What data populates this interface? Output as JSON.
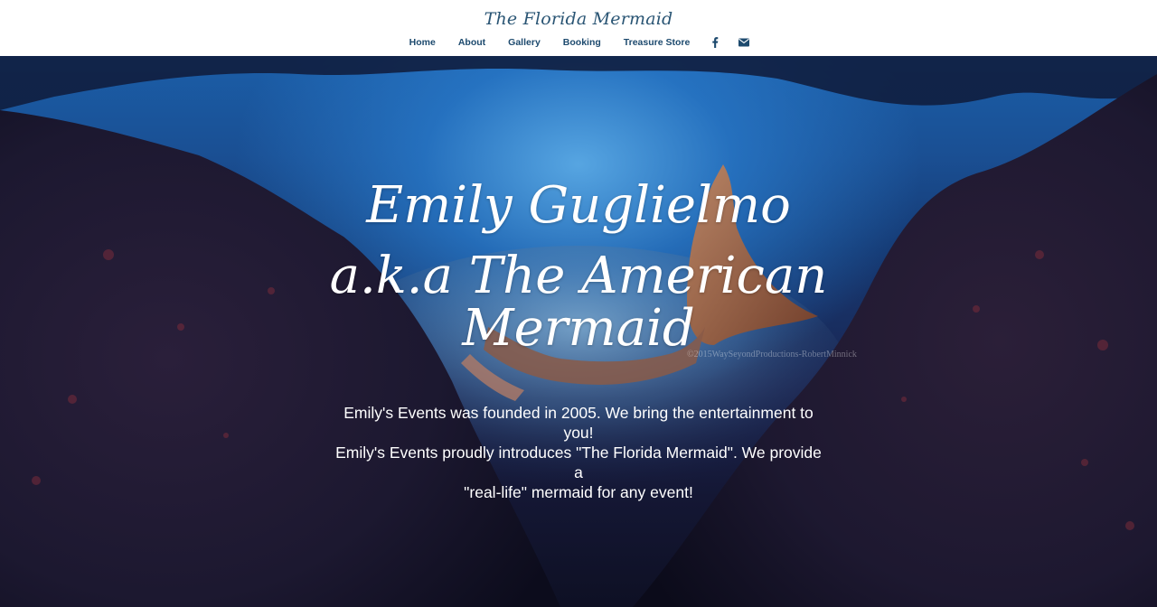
{
  "header": {
    "logo": "The Florida Mermaid",
    "nav": [
      {
        "label": "Home"
      },
      {
        "label": "About"
      },
      {
        "label": "Gallery"
      },
      {
        "label": "Booking"
      },
      {
        "label": "Treasure Store"
      }
    ],
    "icons": [
      "facebook-icon",
      "mail-icon"
    ]
  },
  "hero": {
    "title_line1": "Emily Guglielmo",
    "title_line2": "a.k.a The American",
    "title_line3": "Mermaid",
    "paragraph_line1": "Emily's Events was founded in 2005. We bring the entertainment to you!",
    "paragraph_line2": "Emily's Events proudly introduces \"The Florida Mermaid\". We provide a",
    "paragraph_line3": "\"real-life\" mermaid for any event!",
    "watermark": "©2015WaySeyondProductions-RobertMinnick"
  },
  "colors": {
    "nav_text": "#1d4a6e",
    "logo_text": "#2a5574",
    "hero_text": "#ffffff",
    "water": "#1b5ea8"
  }
}
